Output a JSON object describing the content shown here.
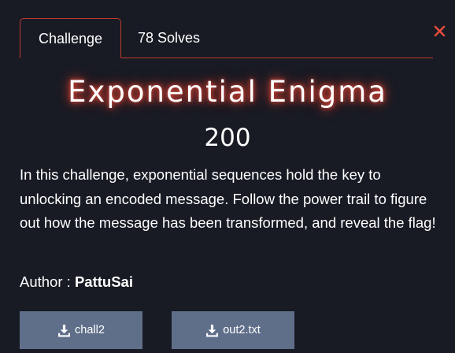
{
  "tabs": [
    {
      "label": "Challenge",
      "active": true
    },
    {
      "label": "78 Solves",
      "active": false
    }
  ],
  "close_icon": "close-icon",
  "challenge": {
    "title": "Exponential Enigma",
    "points": "200",
    "description": "In this challenge, exponential sequences hold the key to unlocking an encoded message. Follow the power trail to figure out how the message has been transformed, and reveal the flag!",
    "author_label": "Author : ",
    "author_name": "PattuSai"
  },
  "files": [
    {
      "name": "chall2",
      "icon": "download-icon"
    },
    {
      "name": "out2.txt",
      "icon": "download-icon"
    }
  ],
  "colors": {
    "background": "#181b24",
    "accent": "#c0392b",
    "button": "#5f6f8a",
    "text": "#ffffff"
  }
}
